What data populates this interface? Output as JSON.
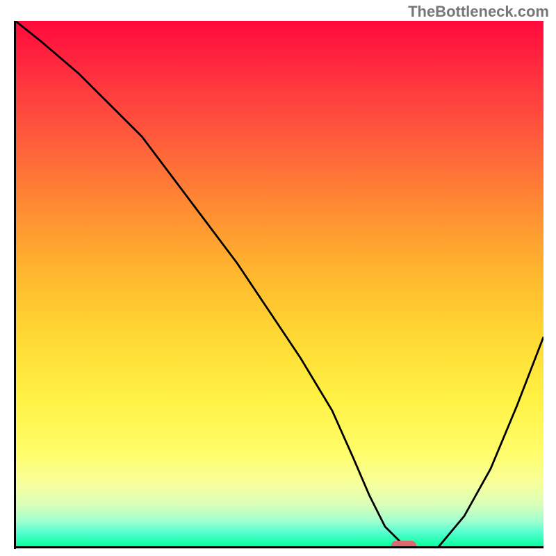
{
  "watermark": "TheBottleneck.com",
  "chart_data": {
    "type": "line",
    "title": "",
    "xlabel": "",
    "ylabel": "",
    "xlim": [
      0,
      100
    ],
    "ylim": [
      0,
      100
    ],
    "x": [
      0,
      5,
      12,
      18,
      24,
      30,
      36,
      42,
      48,
      54,
      60,
      64,
      67,
      70,
      73,
      76,
      80,
      85,
      90,
      95,
      100
    ],
    "values": [
      100,
      96,
      90,
      84,
      78,
      70,
      62,
      54,
      45,
      36,
      26,
      17,
      10,
      4,
      1,
      0,
      0,
      6,
      15,
      27,
      40
    ],
    "marker": {
      "x": 73.5,
      "y": 0
    },
    "background": "vertical gradient red (top) → orange → yellow → green (bottom)"
  }
}
